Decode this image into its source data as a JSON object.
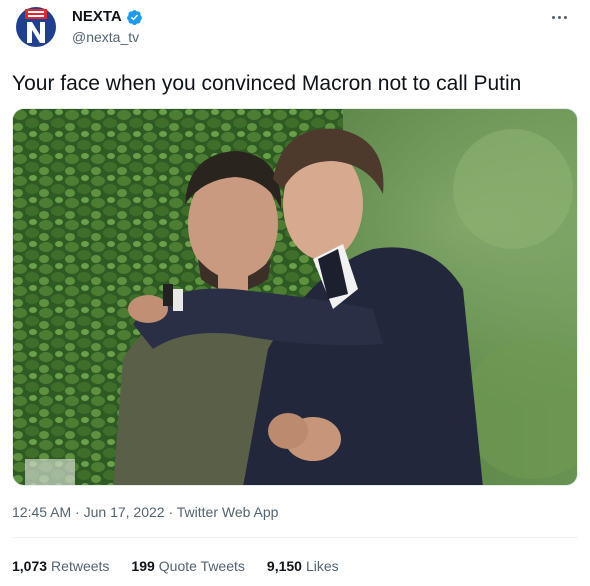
{
  "author": {
    "name": "NEXTA",
    "handle": "@nexta_tv",
    "avatar_icon": "nexta-logo-icon",
    "verified_icon": "verified-badge-icon"
  },
  "tweet": {
    "text": "Your face when you convinced Macron not to call Putin",
    "time": "12:45 AM",
    "separator1": "·",
    "date": "Jun 17, 2022",
    "separator2": "·",
    "source": "Twitter Web App"
  },
  "stats": {
    "retweets": {
      "value": "1,073",
      "label": "Retweets"
    },
    "quotes": {
      "value": "199",
      "label": "Quote Tweets"
    },
    "likes": {
      "value": "9,150",
      "label": "Likes"
    }
  },
  "icons": {
    "more": "more-options-icon"
  },
  "colors": {
    "text_primary": "#0f1419",
    "text_secondary": "#536471",
    "verified": "#1d9bf0",
    "logo_red": "#e3262b",
    "logo_blue": "#1f3f8f"
  }
}
